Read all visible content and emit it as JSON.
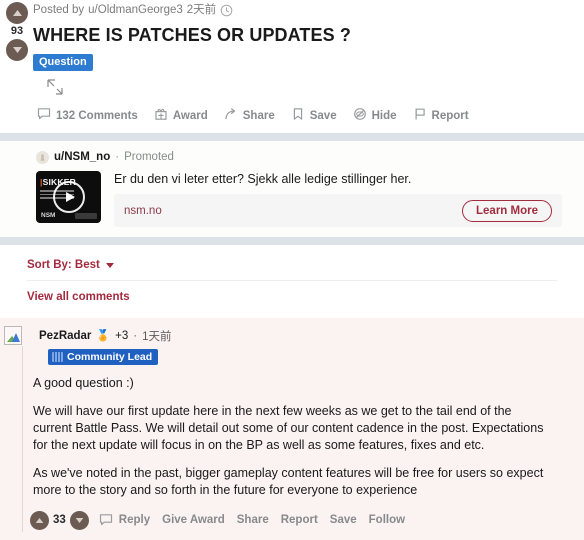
{
  "post": {
    "score": "93",
    "byline_prefix": "Posted by",
    "author": "u/OldmanGeorge3",
    "timestamp": "2天前",
    "title": "WHERE IS PATCHES OR UPDATES ?",
    "flair": "Question",
    "actions": [
      {
        "label": "132 Comments",
        "icon": "comment-icon"
      },
      {
        "label": "Award",
        "icon": "gift-icon"
      },
      {
        "label": "Share",
        "icon": "share-icon"
      },
      {
        "label": "Save",
        "icon": "bookmark-icon"
      },
      {
        "label": "Hide",
        "icon": "eye-off-icon"
      },
      {
        "label": "Report",
        "icon": "flag-icon"
      }
    ]
  },
  "ad": {
    "subreddit": "u/NSM_no",
    "separator": "·",
    "promoted_label": "Promoted",
    "thumbnail_title_prefix": "|",
    "thumbnail_title": "SIKKER",
    "thumbnail_logo": "NSM",
    "text": "Er du den vi leter etter? Sjekk alle ledige stillinger her.",
    "url": "nsm.no",
    "cta_label": "Learn More"
  },
  "comments_header": {
    "sort_label": "Sort By: Best",
    "view_all_label": "View all comments"
  },
  "comment": {
    "author": "PezRadar",
    "award": "🏅",
    "award_count": "+3",
    "separator": "·",
    "timestamp": "1天前",
    "badge": "Community Lead",
    "paragraphs": [
      "A good question :)",
      "We will have our first update here in the next few weeks as we get to the tail end of the current Battle Pass. We will detail out some of our content cadence in the post. Expectations for the next update will focus in on the BP as well as some features, fixes and etc.",
      "As we've noted in the past, bigger gameplay content features will be free for users so expect more to the story and so forth in the future for everyone to experience"
    ],
    "score": "33",
    "actions": [
      "Reply",
      "Give Award",
      "Share",
      "Report",
      "Save",
      "Follow"
    ]
  },
  "colors": {
    "flair_blue": "#2d7cd1",
    "accent_red": "#a32b3f",
    "band_gray": "#dde2e8",
    "comment_bg": "#fbf2f2",
    "badge_blue": "#2060c0"
  }
}
